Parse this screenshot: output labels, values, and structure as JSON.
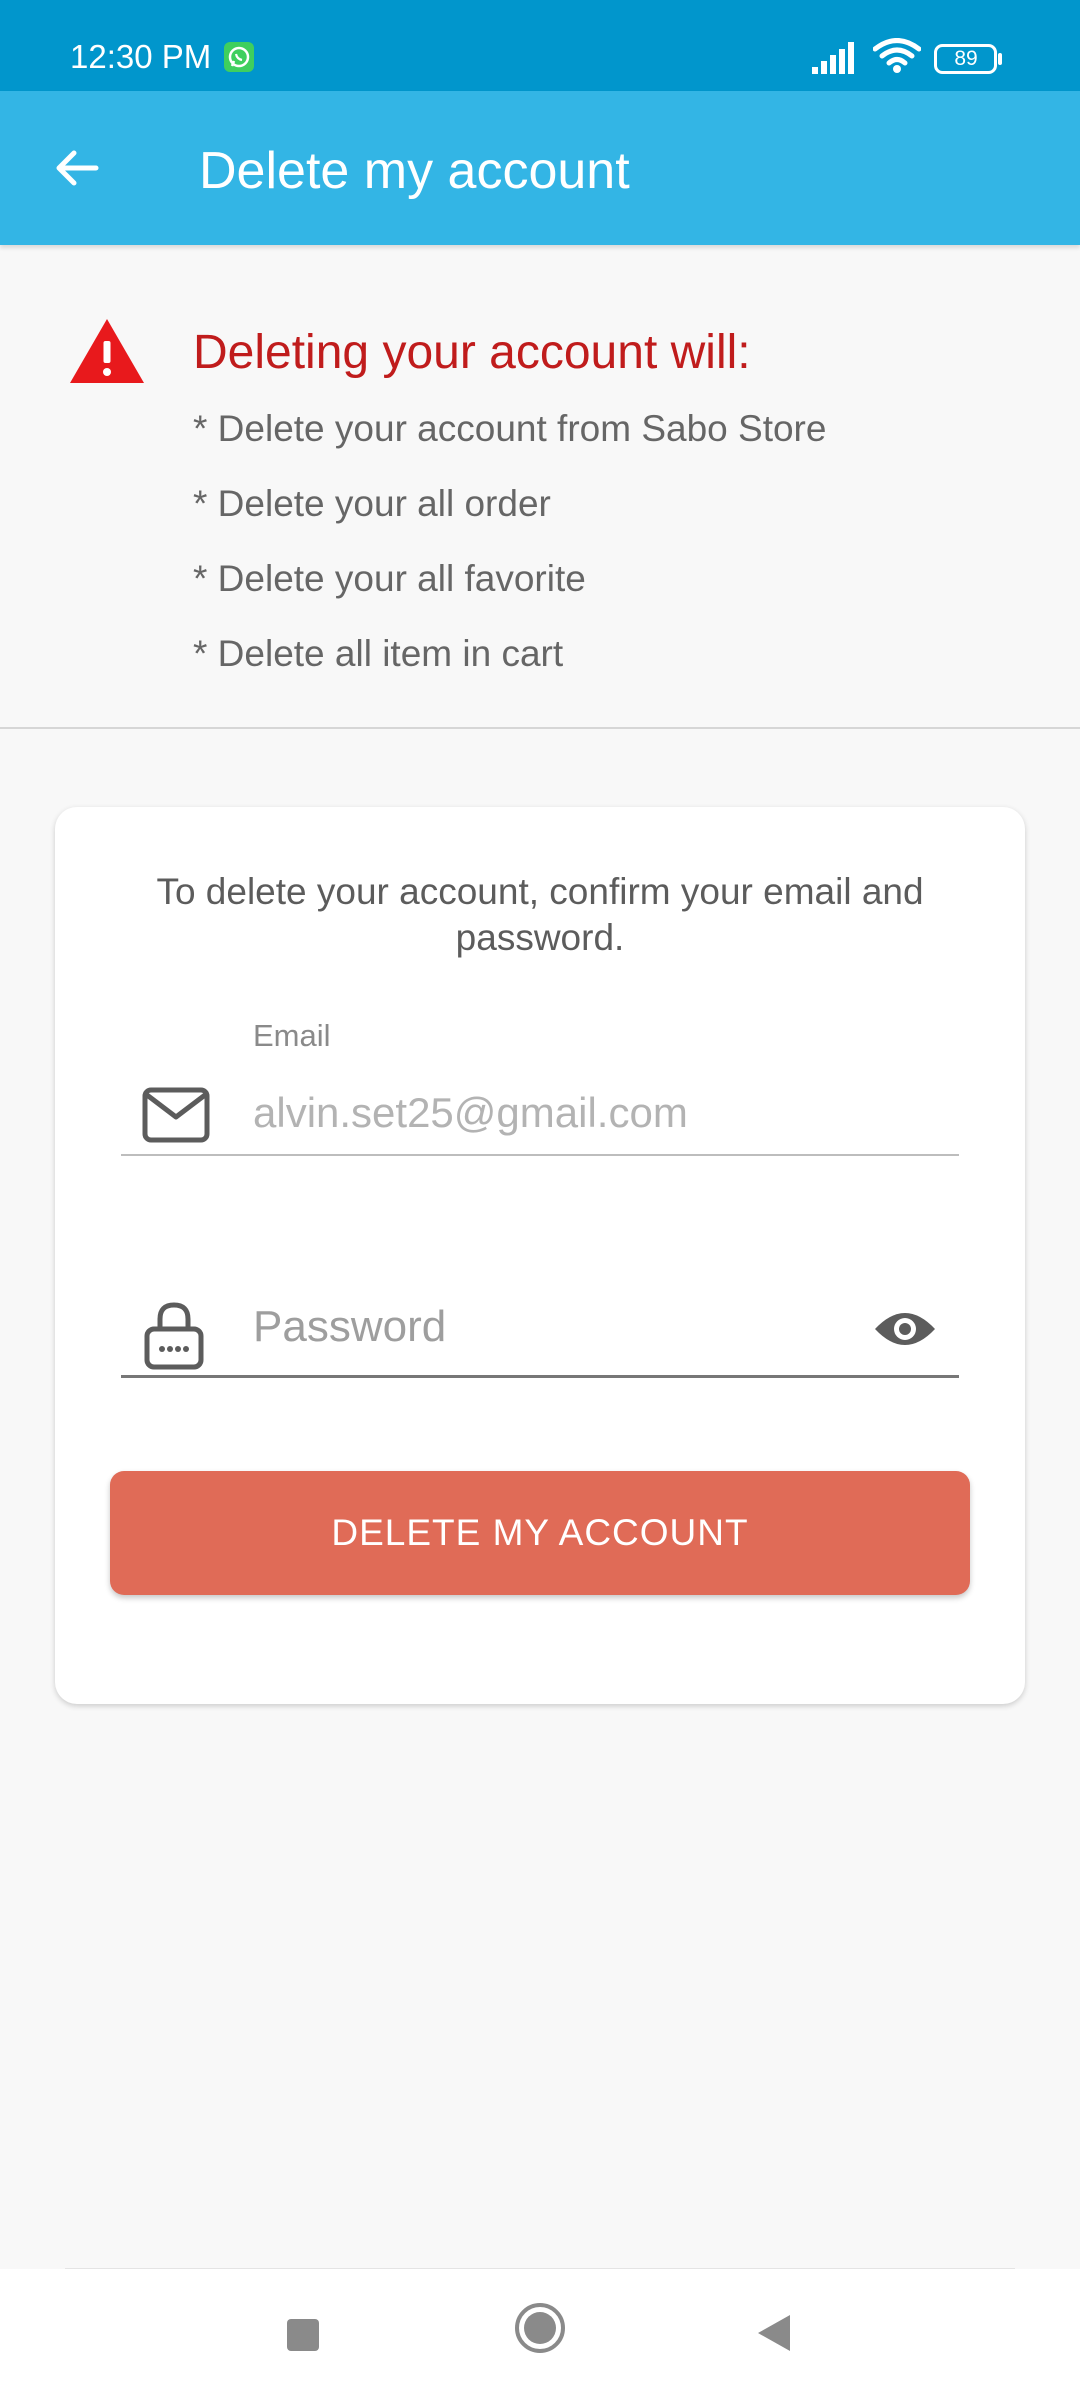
{
  "status_bar": {
    "time": "12:30 PM",
    "battery_level": "89",
    "icons": [
      "whatsapp-icon",
      "signal-icon",
      "wifi-icon",
      "battery-icon"
    ]
  },
  "app_bar": {
    "title": "Delete my account",
    "back_icon": "arrow-left-icon"
  },
  "warning": {
    "icon": "warning-triangle-icon",
    "title": "Deleting your account will:",
    "items": [
      "* Delete your account from Sabo Store",
      "* Delete your all order",
      "* Delete your all favorite",
      "* Delete all item in cart"
    ]
  },
  "form": {
    "intro": "To delete your account, confirm your email and password.",
    "email": {
      "label": "Email",
      "value": "alvin.set25@gmail.com",
      "icon": "envelope-icon"
    },
    "password": {
      "placeholder": "Password",
      "value": "",
      "icon": "lock-icon",
      "toggle_icon": "eye-icon"
    },
    "submit_label": "DELETE MY ACCOUNT"
  },
  "colors": {
    "status_bar": "#0196cc",
    "app_bar": "#33b5e5",
    "warning_text": "#c01c1c",
    "warning_icon": "#e8191c",
    "delete_button": "#e06b57"
  },
  "nav_bar": {
    "icons": [
      "recent-apps-icon",
      "home-icon",
      "back-icon"
    ]
  }
}
